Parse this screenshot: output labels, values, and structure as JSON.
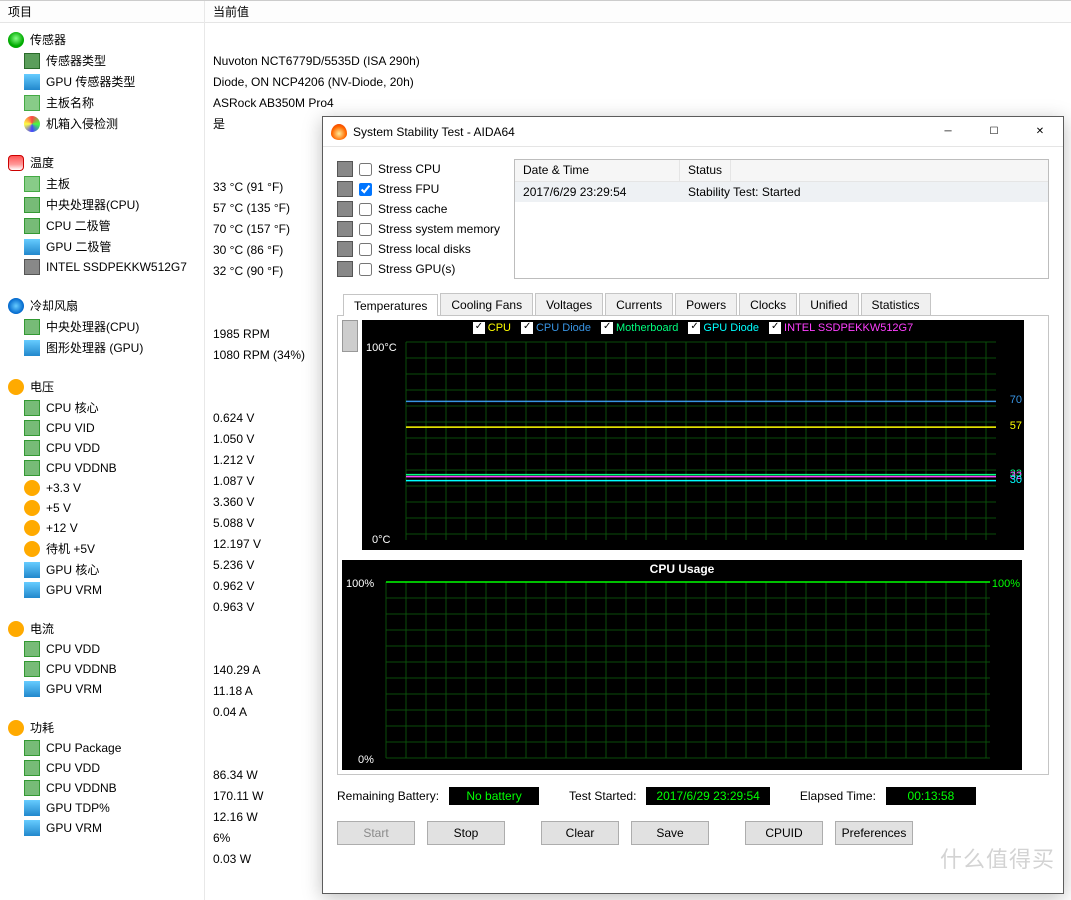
{
  "columns": {
    "left": "项目",
    "right": "当前值"
  },
  "sensors": {
    "header": "传感器",
    "items": [
      {
        "label": "传感器类型",
        "value": "Nuvoton NCT6779D/5535D  (ISA 290h)"
      },
      {
        "label": "GPU 传感器类型",
        "value": "Diode, ON NCP4206  (NV-Diode, 20h)"
      },
      {
        "label": "主板名称",
        "value": "ASRock AB350M Pro4"
      },
      {
        "label": "机箱入侵检测",
        "value": "是"
      }
    ]
  },
  "temperature": {
    "header": "温度",
    "items": [
      {
        "label": "主板",
        "value": "33 °C  (91 °F)"
      },
      {
        "label": "中央处理器(CPU)",
        "value": "57 °C  (135 °F)"
      },
      {
        "label": "CPU 二极管",
        "value": "70 °C  (157 °F)"
      },
      {
        "label": "GPU 二极管",
        "value": "30 °C  (86 °F)"
      },
      {
        "label": "INTEL SSDPEKKW512G7",
        "value": "32 °C  (90 °F)"
      }
    ]
  },
  "fans": {
    "header": "冷却风扇",
    "items": [
      {
        "label": "中央处理器(CPU)",
        "value": "1985 RPM"
      },
      {
        "label": "图形处理器 (GPU)",
        "value": "1080 RPM  (34%)"
      }
    ]
  },
  "voltage": {
    "header": "电压",
    "items": [
      {
        "label": "CPU 核心",
        "value": "0.624 V"
      },
      {
        "label": "CPU VID",
        "value": "1.050 V"
      },
      {
        "label": "CPU VDD",
        "value": "1.212 V"
      },
      {
        "label": "CPU VDDNB",
        "value": "1.087 V"
      },
      {
        "label": "+3.3 V",
        "value": "3.360 V"
      },
      {
        "label": "+5 V",
        "value": "5.088 V"
      },
      {
        "label": "+12 V",
        "value": "12.197 V"
      },
      {
        "label": "待机 +5V",
        "value": "5.236 V"
      },
      {
        "label": "GPU 核心",
        "value": "0.962 V"
      },
      {
        "label": "GPU VRM",
        "value": "0.963 V"
      }
    ]
  },
  "current": {
    "header": "电流",
    "items": [
      {
        "label": "CPU VDD",
        "value": "140.29 A"
      },
      {
        "label": "CPU VDDNB",
        "value": "11.18 A"
      },
      {
        "label": "GPU VRM",
        "value": "0.04 A"
      }
    ]
  },
  "power": {
    "header": "功耗",
    "items": [
      {
        "label": "CPU Package",
        "value": "86.34 W"
      },
      {
        "label": "CPU VDD",
        "value": "170.11 W"
      },
      {
        "label": "CPU VDDNB",
        "value": "12.16 W"
      },
      {
        "label": "GPU TDP%",
        "value": "6%"
      },
      {
        "label": "GPU VRM",
        "value": "0.03 W"
      }
    ]
  },
  "dialog": {
    "title": "System Stability Test - AIDA64",
    "stress": [
      {
        "label": "Stress CPU",
        "checked": false
      },
      {
        "label": "Stress FPU",
        "checked": true
      },
      {
        "label": "Stress cache",
        "checked": false
      },
      {
        "label": "Stress system memory",
        "checked": false
      },
      {
        "label": "Stress local disks",
        "checked": false
      },
      {
        "label": "Stress GPU(s)",
        "checked": false
      }
    ],
    "log": {
      "col1": "Date & Time",
      "col2": "Status",
      "row1c1": "2017/6/29 23:29:54",
      "row1c2": "Stability Test: Started"
    },
    "tabs": [
      "Temperatures",
      "Cooling Fans",
      "Voltages",
      "Currents",
      "Powers",
      "Clocks",
      "Unified",
      "Statistics"
    ],
    "legend": [
      {
        "label": "CPU",
        "color": "#ffff00"
      },
      {
        "label": "CPU Diode",
        "color": "#3894e3"
      },
      {
        "label": "Motherboard",
        "color": "#00ff7f"
      },
      {
        "label": "GPU Diode",
        "color": "#00ffff"
      },
      {
        "label": "INTEL SSDPEKKW512G7",
        "color": "#ff40ff"
      }
    ],
    "temp_axis": {
      "top": "100°C",
      "bottom": "0°C"
    },
    "temp_right": [
      {
        "v": "70",
        "pct": 70,
        "color": "#3894e3"
      },
      {
        "v": "57",
        "pct": 57,
        "color": "#ffff00"
      },
      {
        "v": "33",
        "pct": 33,
        "color": "#00ff7f"
      },
      {
        "v": "32",
        "pct": 32,
        "color": "#ff40ff"
      },
      {
        "v": "30",
        "pct": 30,
        "color": "#00ffff"
      }
    ],
    "cpu_title": "CPU Usage",
    "cpu_axis": {
      "top": "100%",
      "bottom": "0%"
    },
    "cpu_right": "100%",
    "status": {
      "battery_label": "Remaining Battery:",
      "battery": "No battery",
      "started_label": "Test Started:",
      "started": "2017/6/29 23:29:54",
      "elapsed_label": "Elapsed Time:",
      "elapsed": "00:13:58"
    },
    "buttons": {
      "start": "Start",
      "stop": "Stop",
      "clear": "Clear",
      "save": "Save",
      "cpuid": "CPUID",
      "prefs": "Preferences"
    }
  },
  "chart_data": [
    {
      "type": "line",
      "title": "Temperatures",
      "ylabel": "°C",
      "ylim": [
        0,
        100
      ],
      "legend": [
        "CPU",
        "CPU Diode",
        "Motherboard",
        "GPU Diode",
        "INTEL SSDPEKKW512G7"
      ],
      "series": [
        {
          "name": "CPU",
          "values": [
            57
          ],
          "color": "#ffff00"
        },
        {
          "name": "CPU Diode",
          "values": [
            70
          ],
          "color": "#3894e3"
        },
        {
          "name": "Motherboard",
          "values": [
            33
          ],
          "color": "#00ff7f"
        },
        {
          "name": "GPU Diode",
          "values": [
            30
          ],
          "color": "#00ffff"
        },
        {
          "name": "INTEL SSDPEKKW512G7",
          "values": [
            32
          ],
          "color": "#ff40ff"
        }
      ]
    },
    {
      "type": "line",
      "title": "CPU Usage",
      "ylabel": "%",
      "ylim": [
        0,
        100
      ],
      "series": [
        {
          "name": "CPU Usage",
          "values": [
            100
          ],
          "color": "#00ff00"
        }
      ]
    }
  ],
  "watermark": "什么值得买"
}
